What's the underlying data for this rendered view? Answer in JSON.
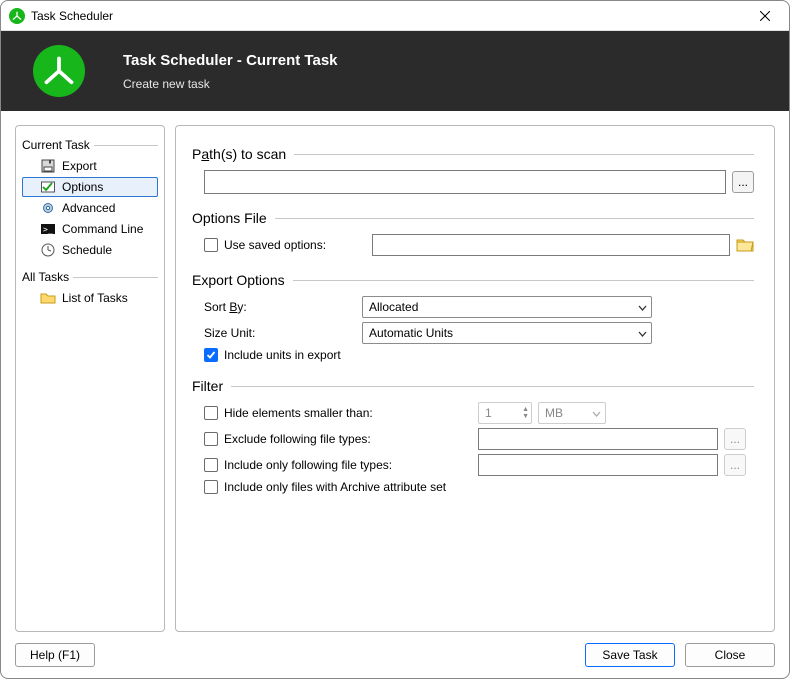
{
  "titlebar": {
    "title": "Task Scheduler"
  },
  "header": {
    "title": "Task Scheduler - Current Task",
    "subtitle": "Create new task"
  },
  "sidebar": {
    "groups": [
      {
        "title": "Current Task",
        "items": [
          {
            "label": "Export"
          },
          {
            "label": "Options"
          },
          {
            "label": "Advanced"
          },
          {
            "label": "Command Line"
          },
          {
            "label": "Schedule"
          }
        ]
      },
      {
        "title": "All Tasks",
        "items": [
          {
            "label": "List of Tasks"
          }
        ]
      }
    ]
  },
  "sections": {
    "paths": {
      "title_pre": "P",
      "title_accel": "a",
      "title_post": "th(s) to scan",
      "value": "",
      "ellipsis": "..."
    },
    "options_file": {
      "title": "Options File",
      "use_saved_label": "Use saved options:",
      "use_saved_checked": false,
      "value": ""
    },
    "export": {
      "title": "Export Options",
      "sortby_label_pre": "Sort ",
      "sortby_accel": "B",
      "sortby_label_post": "y:",
      "sortby_value": "Allocated",
      "sizeunit_label": "Size Unit:",
      "sizeunit_value": "Automatic Units",
      "include_units_label": "Include units in export",
      "include_units_checked": true
    },
    "filter": {
      "title": "Filter",
      "hide_label": "Hide elements smaller than:",
      "hide_checked": false,
      "hide_value": "1",
      "hide_unit": "MB",
      "exclude_label": "Exclude following file types:",
      "exclude_checked": false,
      "exclude_value": "",
      "include_types_label": "Include only following file types:",
      "include_types_checked": false,
      "include_types_value": "",
      "archive_label": "Include only files with Archive attribute set",
      "archive_checked": false,
      "ellipsis": "..."
    }
  },
  "footer": {
    "help": "Help (F1)",
    "save": "Save Task",
    "close": "Close"
  }
}
